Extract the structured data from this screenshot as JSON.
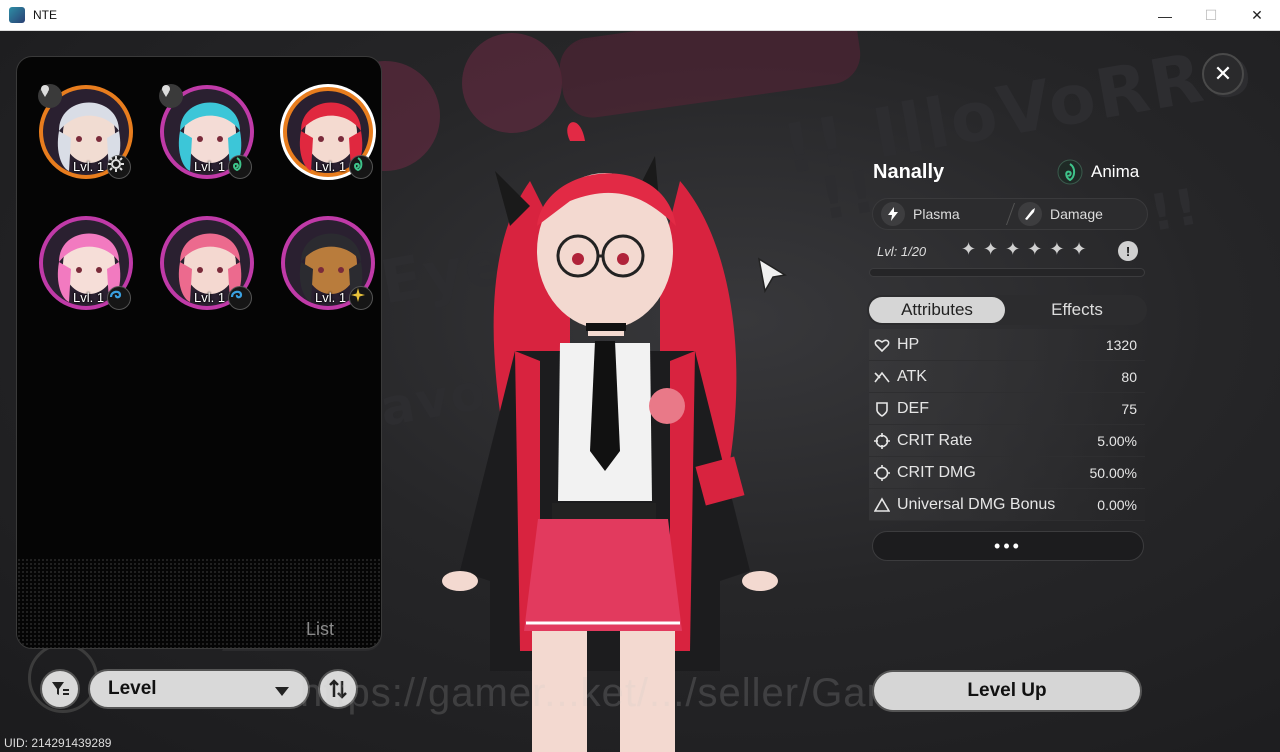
{
  "window": {
    "title": "NTE",
    "minimize_glyph": "—",
    "maximize_glyph": "☐",
    "close_glyph": "✕"
  },
  "roster": {
    "tab_label": "List",
    "characters": [
      {
        "level": "Lvl. 1",
        "ring_color": "#e87d1e",
        "element_icon": "gear-icon",
        "pinned": true,
        "selected": false
      },
      {
        "level": "Lvl. 1",
        "ring_color": "#c03aa8",
        "element_icon": "spiral-leaf-icon",
        "pinned": true,
        "selected": false
      },
      {
        "level": "Lvl. 1",
        "ring_color": "#e87d1e",
        "element_icon": "spiral-leaf-icon",
        "pinned": false,
        "selected": true
      },
      {
        "level": "Lvl. 1",
        "ring_color": "#c03aa8",
        "element_icon": "wave-icon",
        "pinned": false,
        "selected": false
      },
      {
        "level": "Lvl. 1",
        "ring_color": "#c03aa8",
        "element_icon": "wave-icon",
        "pinned": false,
        "selected": false
      },
      {
        "level": "Lvl. 1",
        "ring_color": "#c03aa8",
        "element_icon": "star-burst-icon",
        "pinned": false,
        "selected": false
      }
    ]
  },
  "controls": {
    "sort_label": "Level",
    "watermark": "https://gamer...ket/.../seller/GameNe...",
    "uid": "UID: 214291439289"
  },
  "character": {
    "name": "Nanally",
    "attribute": "Anima",
    "attribute_color": "#3ec48a",
    "type1": "Plasma",
    "type2": "Damage",
    "level_current": "1",
    "level_max": "/20",
    "level_prefix": "Lvl:",
    "stars": [
      "✦",
      "✦",
      "✦",
      "✦",
      "✦",
      "✦"
    ],
    "info_glyph": "!",
    "xp_fraction": 0.0,
    "tabs": [
      "Attributes",
      "Effects"
    ],
    "active_tab": "Attributes",
    "stats": [
      {
        "name": "HP",
        "value": "1320",
        "icon": "heart-icon"
      },
      {
        "name": "ATK",
        "value": "80",
        "icon": "attack-icon"
      },
      {
        "name": "DEF",
        "value": "75",
        "icon": "shield-icon"
      },
      {
        "name": "CRIT Rate",
        "value": "5.00%",
        "icon": "crosshair-icon"
      },
      {
        "name": "CRIT DMG",
        "value": "50.00%",
        "icon": "crit-dmg-icon"
      },
      {
        "name": "Universal DMG Bonus",
        "value": "0.00%",
        "icon": "triangle-icon"
      }
    ],
    "more_label": "•••",
    "level_up_label": "Level Up"
  },
  "close_glyph": "✕",
  "colors": {
    "accent_pink": "#e23a5e",
    "ring_orange": "#e87d1e",
    "ring_magenta": "#c03aa8",
    "anima_green": "#3ec48a"
  }
}
